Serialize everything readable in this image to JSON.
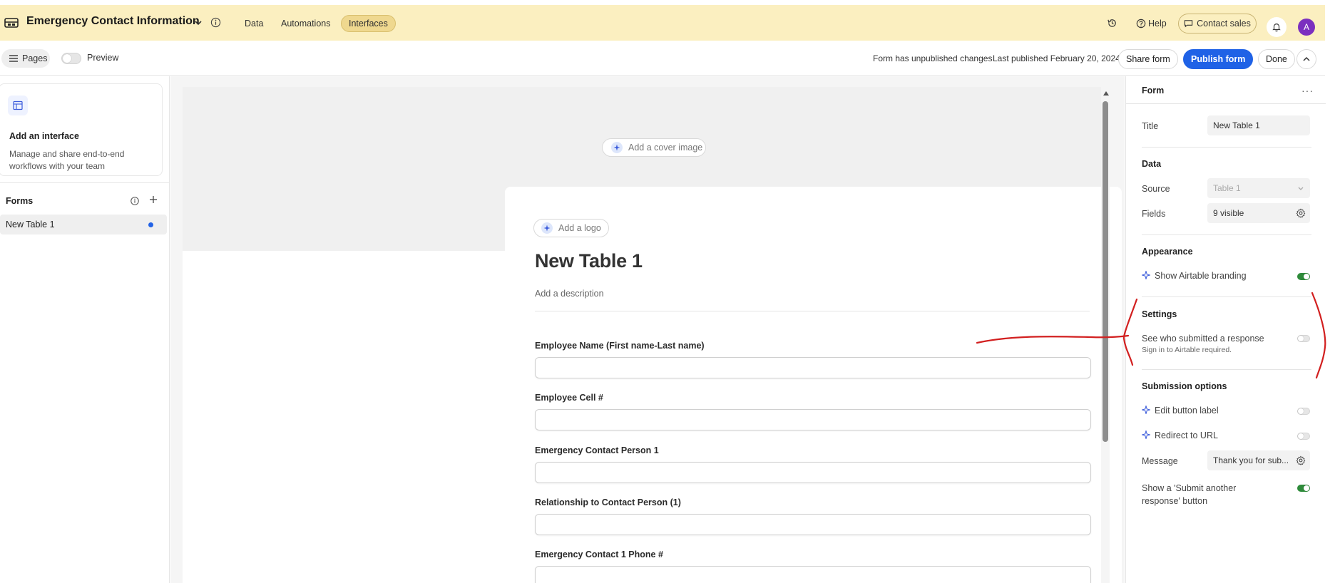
{
  "header": {
    "base_title": "Emergency Contact Information",
    "nav": [
      "Data",
      "Automations",
      "Interfaces"
    ],
    "active_nav": "Interfaces",
    "help_label": "Help",
    "contact_sales_label": "Contact sales",
    "avatar_initial": "A",
    "bg_color": "#fbefc0"
  },
  "toolbar": {
    "pages_label": "Pages",
    "preview_label": "Preview",
    "unpublished_status": "Form has unpublished changes",
    "last_published": "Last published February 20, 2024",
    "share_label": "Share form",
    "publish_label": "Publish form",
    "done_label": "Done",
    "publish_color": "#1f62e6"
  },
  "sidebar": {
    "card_title": "Add an interface",
    "card_desc": "Manage and share end-to-end workflows with your team",
    "forms_heading": "Forms",
    "form_items": [
      "New Table 1"
    ]
  },
  "form": {
    "cover_label": "Add a cover image",
    "logo_label": "Add a logo",
    "title": "New Table 1",
    "description_placeholder": "Add a description",
    "fields": [
      "Employee Name (First name-Last name)",
      "Employee Cell #",
      "Emergency Contact Person 1",
      "Relationship to Contact Person (1)",
      "Emergency Contact 1 Phone #"
    ]
  },
  "panel": {
    "heading": "Form",
    "title_label": "Title",
    "title_value": "New Table 1",
    "data_heading": "Data",
    "source_label": "Source",
    "source_value": "Table 1",
    "fields_label": "Fields",
    "fields_value": "9 visible",
    "appearance_heading": "Appearance",
    "branding_label": "Show Airtable branding",
    "branding_on": true,
    "settings_heading": "Settings",
    "see_who_label": "See who submitted a response",
    "see_who_sub": "Sign in to Airtable required.",
    "see_who_on": false,
    "submission_heading": "Submission options",
    "edit_button_label": "Edit button label",
    "redirect_label": "Redirect to URL",
    "message_label": "Message",
    "message_value": "Thank you for sub...",
    "submit_another_label": "Show a 'Submit another response' button",
    "submit_another_on": true,
    "toggle_on_color": "#2e8b3a"
  },
  "annotation_color": "#d21f1f"
}
